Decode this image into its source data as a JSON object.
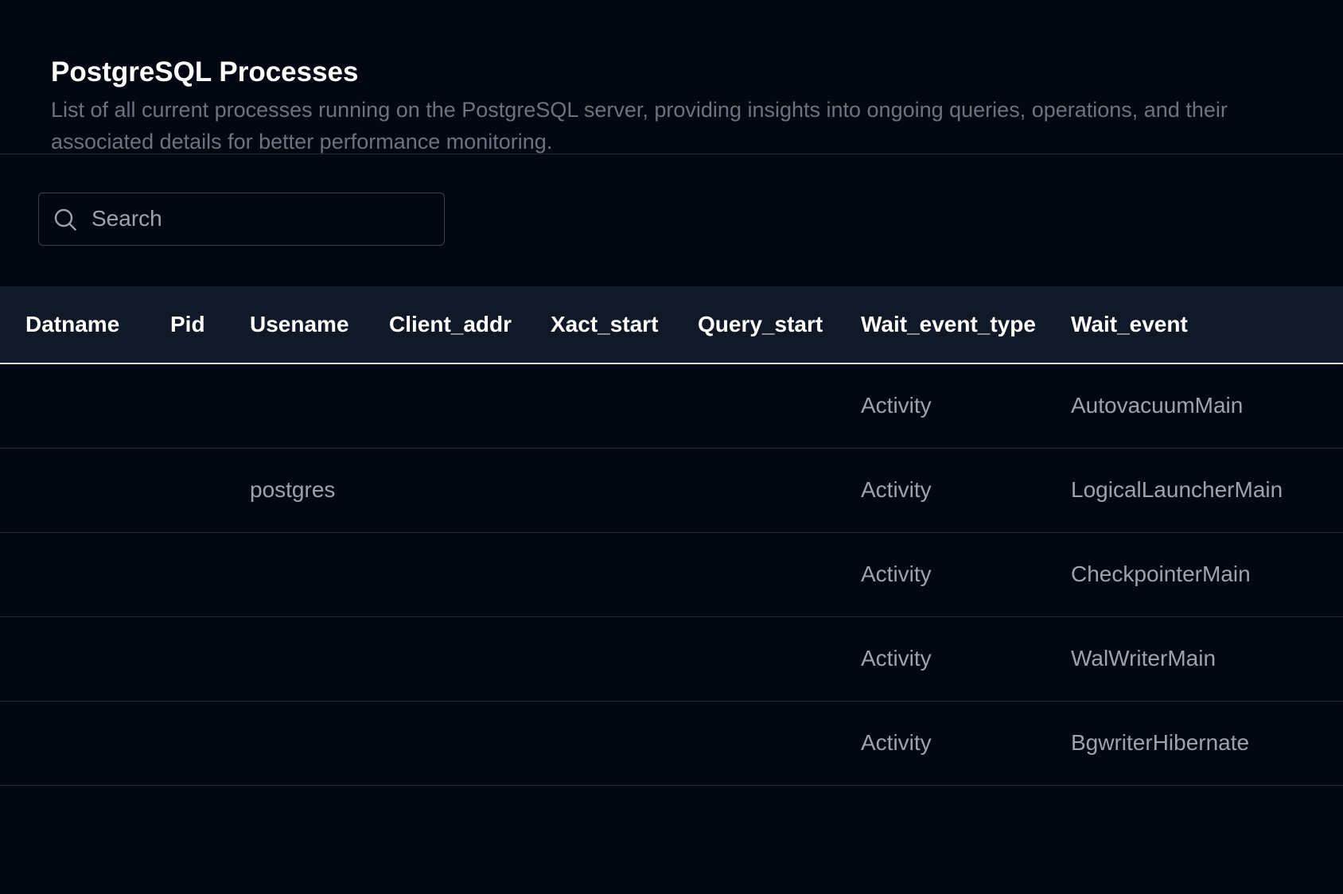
{
  "header": {
    "title": "PostgreSQL Processes",
    "description": "List of all current processes running on the PostgreSQL server, providing insights into ongoing queries, operations, and their associated details for better performance monitoring."
  },
  "search": {
    "placeholder": "Search",
    "value": "",
    "icon": "search-icon"
  },
  "table": {
    "columns": [
      "Datname",
      "Pid",
      "Usename",
      "Client_addr",
      "Xact_start",
      "Query_start",
      "Wait_event_type",
      "Wait_event"
    ],
    "rows": [
      [
        "",
        "",
        "",
        "",
        "",
        "",
        "Activity",
        "AutovacuumMain"
      ],
      [
        "",
        "",
        "postgres",
        "",
        "",
        "",
        "Activity",
        "LogicalLauncherMain"
      ],
      [
        "",
        "",
        "",
        "",
        "",
        "",
        "Activity",
        "CheckpointerMain"
      ],
      [
        "",
        "",
        "",
        "",
        "",
        "",
        "Activity",
        "WalWriterMain"
      ],
      [
        "",
        "",
        "",
        "",
        "",
        "",
        "Activity",
        "BgwriterHibernate"
      ]
    ]
  },
  "colors": {
    "background": "#030712",
    "header_row": "#111827",
    "title": "#ffffff",
    "muted_text": "#6b7280",
    "cell_text": "#9ca3af",
    "divider": "#1f2937"
  }
}
